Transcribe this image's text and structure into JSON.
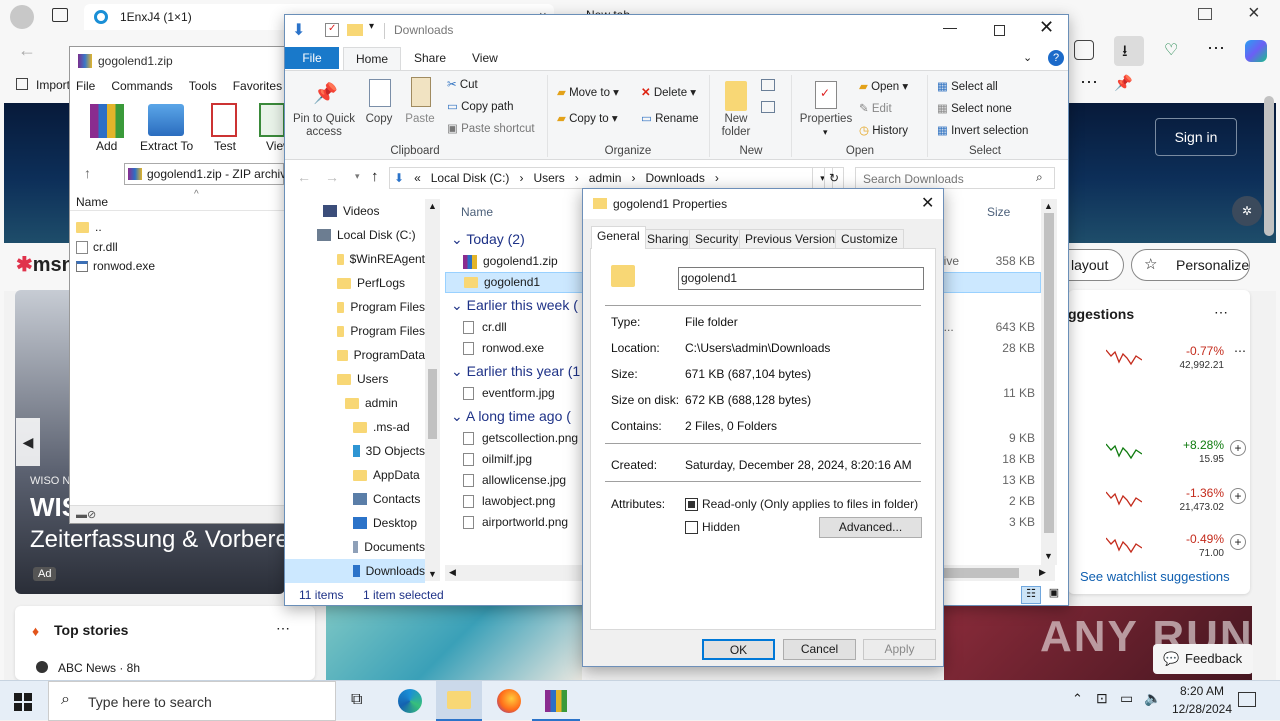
{
  "edge": {
    "tab1_title": "1EnxJ4 (1×1)",
    "tab2_title": "New tab",
    "favorites": [
      "Import favorites"
    ],
    "sign_in": "Sign in",
    "msn_logo": "msn",
    "layout_btn": "layout",
    "personalize": "Personalize",
    "suggestions_title": "ggestions",
    "see_watchlist": "See watchlist suggestions",
    "feedback": "Feedback",
    "ad_label": "Ad",
    "wiso_small": "WISO N",
    "wiso_big": "WIS",
    "wiso_line": "Zeiterfassung & Vorbere",
    "top_stories": "Top stories",
    "abc_news": "ABC News · 8h",
    "stocks": [
      {
        "change": "-0.77%",
        "price": "42,992.21",
        "color": "#c42b1c"
      },
      {
        "change": "+8.28%",
        "price": "15.95",
        "color": "#0f7b0f"
      },
      {
        "change": "-1.36%",
        "price": "21,473.02",
        "color": "#c42b1c"
      },
      {
        "change": "-0.49%",
        "price": "71.00",
        "color": "#c42b1c"
      }
    ],
    "watermark": "ANY RUN"
  },
  "rar": {
    "title": "gogolend1.zip",
    "menu": [
      "File",
      "Commands",
      "Tools",
      "Favorites"
    ],
    "tools": [
      "Add",
      "Extract To",
      "Test",
      "View"
    ],
    "path": "gogolend1.zip - ZIP archive",
    "col_name": "Name",
    "files": [
      "..",
      "cr.dll",
      "ronwod.exe"
    ]
  },
  "explorer": {
    "title": "Downloads",
    "tabs": [
      "File",
      "Home",
      "Share",
      "View"
    ],
    "clipboard": {
      "pin": "Pin to Quick access",
      "copy": "Copy",
      "paste": "Paste",
      "cut": "Cut",
      "copy_path": "Copy path",
      "paste_shortcut": "Paste shortcut",
      "label": "Clipboard"
    },
    "organize": {
      "move_to": "Move to",
      "copy_to": "Copy to",
      "delete": "Delete",
      "rename": "Rename",
      "label": "Organize"
    },
    "new": {
      "new_folder": "New folder",
      "label": "New"
    },
    "open": {
      "properties": "Properties",
      "open": "Open",
      "edit": "Edit",
      "history": "History",
      "label": "Open"
    },
    "select": {
      "select_all": "Select all",
      "select_none": "Select none",
      "invert": "Invert selection",
      "label": "Select"
    },
    "breadcrumb": [
      "«",
      "Local Disk (C:)",
      "Users",
      "admin",
      "Downloads"
    ],
    "search_placeholder": "Search Downloads",
    "nav": [
      "Videos",
      "Local Disk (C:)",
      "$WinREAgent",
      "PerfLogs",
      "Program Files",
      "Program Files",
      "ProgramData",
      "Users",
      "admin",
      ".ms-ad",
      "3D Objects",
      "AppData",
      "Contacts",
      "Desktop",
      "Documents",
      "Downloads"
    ],
    "col_name": "Name",
    "col_size": "Size",
    "groups": [
      {
        "label": "Today (2)",
        "files": [
          {
            "name": "gogolend1.zip",
            "type": "rchive",
            "size": "358 KB"
          },
          {
            "name": "gogolend1",
            "type": "",
            "size": ""
          }
        ]
      },
      {
        "label": "Earlier this week (",
        "files": [
          {
            "name": "cr.dll",
            "type": "ten...",
            "size": "643 KB"
          },
          {
            "name": "ronwod.exe",
            "type": "",
            "size": "28 KB"
          }
        ]
      },
      {
        "label": "Earlier this year (1",
        "files": [
          {
            "name": "eventform.jpg",
            "type": "",
            "size": "11 KB"
          }
        ]
      },
      {
        "label": "A long time ago (",
        "files": [
          {
            "name": "getscollection.png",
            "type": "",
            "size": "9 KB"
          },
          {
            "name": "oilmilf.jpg",
            "type": "",
            "size": "18 KB"
          },
          {
            "name": "allowlicense.jpg",
            "type": "",
            "size": "13 KB"
          },
          {
            "name": "lawobject.png",
            "type": "",
            "size": "2 KB"
          },
          {
            "name": "airportworld.png",
            "type": "",
            "size": "3 KB"
          }
        ]
      }
    ],
    "status_items": "11 items",
    "status_selected": "1 item selected"
  },
  "dialog": {
    "title": "gogolend1 Properties",
    "tabs": [
      "General",
      "Sharing",
      "Security",
      "Previous Versions",
      "Customize"
    ],
    "name_value": "gogolend1",
    "type_label": "Type:",
    "type": "File folder",
    "location_label": "Location:",
    "location": "C:\\Users\\admin\\Downloads",
    "size_label": "Size:",
    "size": "671 KB (687,104 bytes)",
    "size_on_disk_label": "Size on disk:",
    "size_on_disk": "672 KB (688,128 bytes)",
    "contains_label": "Contains:",
    "contains": "2 Files, 0 Folders",
    "created_label": "Created:",
    "created": "Saturday, December 28, 2024, 8:20:16 AM",
    "attributes_label": "Attributes:",
    "readonly": "Read-only (Only applies to files in folder)",
    "hidden": "Hidden",
    "advanced": "Advanced...",
    "ok": "OK",
    "cancel": "Cancel",
    "apply": "Apply"
  },
  "taskbar": {
    "search": "Type here to search",
    "time": "8:20 AM",
    "date": "12/28/2024"
  }
}
